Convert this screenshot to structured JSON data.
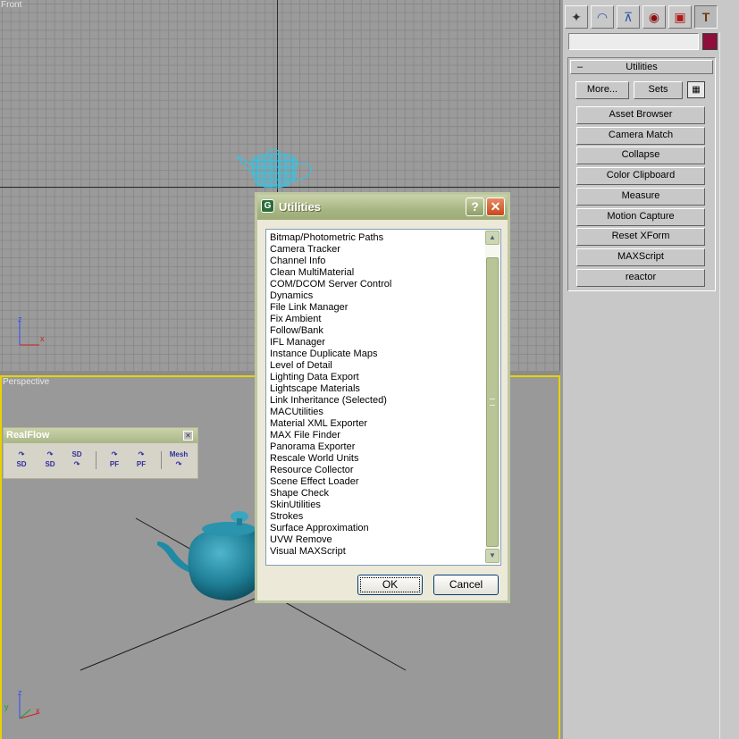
{
  "viewports": {
    "front_label": "Front",
    "perspective_label": "Perspective",
    "axis_x": "x",
    "axis_y": "y",
    "axis_z": "z"
  },
  "command_panel": {
    "tab_icons": [
      "create-icon",
      "modify-icon",
      "hierarchy-icon",
      "motion-icon",
      "display-icon",
      "utilities-icon"
    ],
    "object_name": "",
    "object_color": "#8f0f3c",
    "rollout_title": "Utilities",
    "rollout_collapse": "–",
    "more_label": "More...",
    "sets_label": "Sets",
    "utilities": [
      "Asset Browser",
      "Camera Match",
      "Collapse",
      "Color Clipboard",
      "Measure",
      "Motion Capture",
      "Reset XForm",
      "MAXScript",
      "reactor"
    ]
  },
  "dialog": {
    "title": "Utilities",
    "help_label": "?",
    "close_label": "✕",
    "items": [
      "Bitmap/Photometric Paths",
      "Camera Tracker",
      "Channel Info",
      "Clean MultiMaterial",
      "COM/DCOM Server Control",
      "Dynamics",
      "File Link Manager",
      "Fix Ambient",
      "Follow/Bank",
      "IFL Manager",
      "Instance Duplicate Maps",
      "Level of Detail",
      "Lighting Data Export",
      "Lightscape Materials",
      "Link Inheritance (Selected)",
      "MACUtilities",
      "Material XML Exporter",
      "MAX File Finder",
      "Panorama Exporter",
      "Rescale World Units",
      "Resource Collector",
      "Scene Effect Loader",
      "Shape Check",
      "SkinUtilities",
      "Strokes",
      "Surface Approximation",
      "UVW Remove",
      "Visual MAXScript"
    ],
    "ok_label": "OK",
    "cancel_label": "Cancel"
  },
  "realflow": {
    "title": "RealFlow",
    "close_label": "✕",
    "buttons": [
      "SD",
      "SD",
      "SD",
      "PF",
      "PF",
      "Mesh"
    ]
  }
}
